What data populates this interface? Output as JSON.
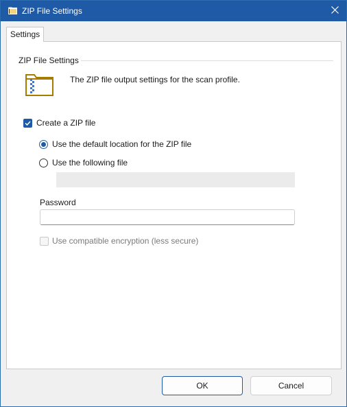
{
  "window": {
    "title": "ZIP File Settings",
    "icon": "folder-icon",
    "close_icon": "close-icon"
  },
  "tabs": [
    {
      "label": "Settings",
      "selected": true
    }
  ],
  "group": {
    "title": "ZIP File Settings",
    "icon": "zip-folder-icon",
    "description": "The ZIP file output settings for the scan profile."
  },
  "options": {
    "create_zip": {
      "label": "Create a ZIP file",
      "checked": true
    },
    "default_location": {
      "label": "Use the default location for the ZIP file",
      "selected": true
    },
    "following_file": {
      "label": "Use the following file",
      "selected": false,
      "value": ""
    },
    "password": {
      "label": "Password",
      "value": ""
    },
    "compatible_encryption": {
      "label": "Use compatible encryption (less secure)",
      "checked": false,
      "enabled": false
    }
  },
  "buttons": {
    "ok": "OK",
    "cancel": "Cancel"
  },
  "colors": {
    "accent": "#1f5aa6",
    "titlebar": "#1f5aa6",
    "icon_gold": "#a67c00"
  }
}
